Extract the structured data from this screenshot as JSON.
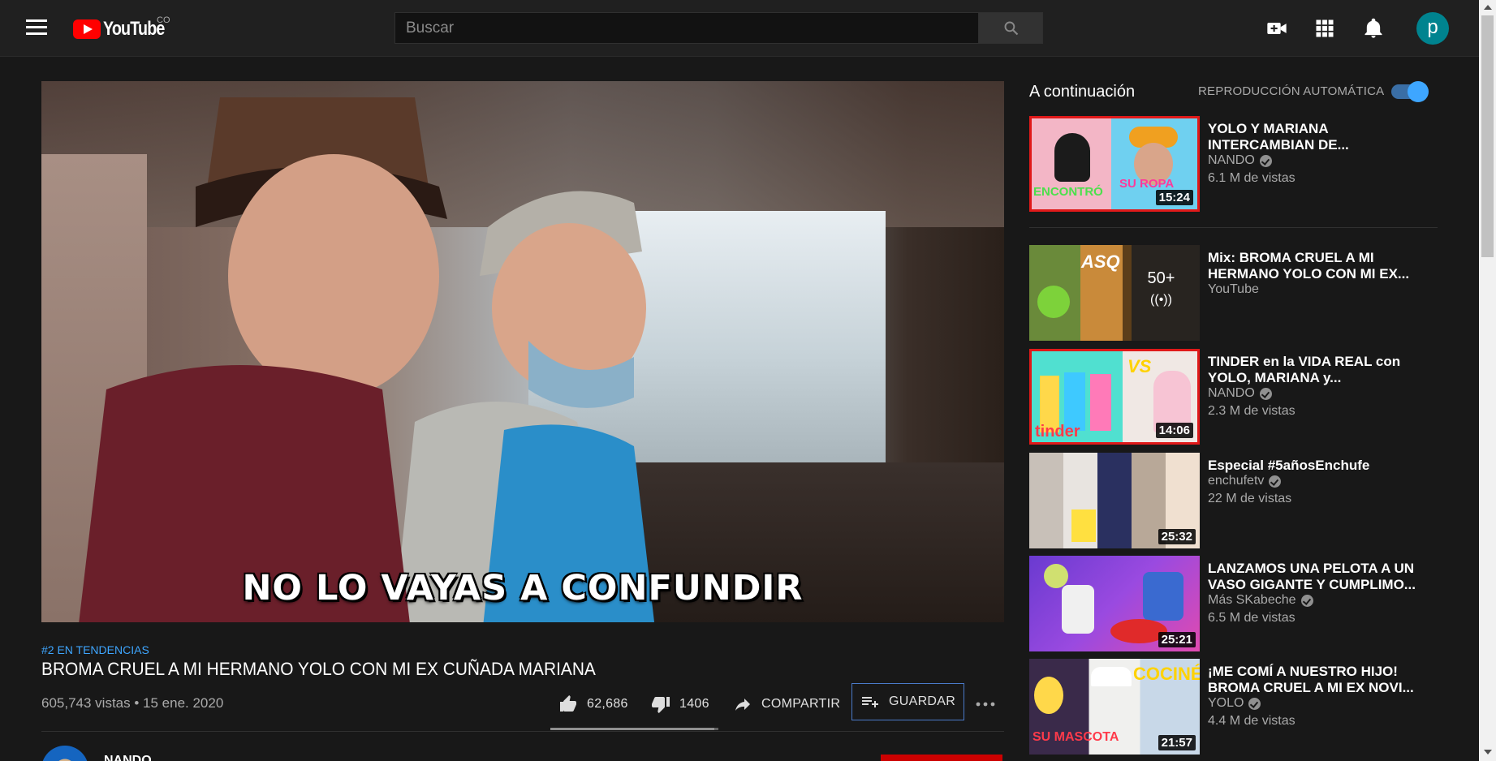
{
  "header": {
    "logo_text": "YouTube",
    "country_code": "CO",
    "search_placeholder": "Buscar",
    "avatar_letter": "p",
    "icons": [
      "menu-icon",
      "search-icon",
      "create-video-icon",
      "apps-icon",
      "notifications-icon"
    ]
  },
  "player": {
    "caption": "NO LO VAYAS A CONFUNDIR"
  },
  "video": {
    "trending": "#2 EN TENDENCIAS",
    "title": "BROMA CRUEL A MI HERMANO YOLO CON MI EX CUÑADA MARIANA",
    "meta": "605,743 vistas • 15 ene. 2020",
    "likes": "62,686",
    "dislikes": "1406",
    "share_label": "COMPARTIR",
    "save_label": "GUARDAR",
    "like_ratio": 0.978,
    "owner_name": "NANDO"
  },
  "sidebar": {
    "up_next": "A continuación",
    "autoplay_label": "REPRODUCCIÓN AUTOMÁTICA",
    "autoplay_on": true,
    "items": [
      {
        "title": "YOLO Y MARIANA INTERCAMBIAN DE...",
        "channel": "NANDO",
        "verified": true,
        "views": "6.1 M de vistas",
        "duration": "15:24"
      },
      {
        "title": "Mix: BROMA CRUEL A MI HERMANO YOLO CON MI EX...",
        "channel": "YouTube",
        "verified": false,
        "views": "",
        "mix_count": "50+",
        "mix_icon": "((•))"
      },
      {
        "title": "TINDER en la VIDA REAL con YOLO, MARIANA y...",
        "channel": "NANDO",
        "verified": true,
        "views": "2.3 M de vistas",
        "duration": "14:06"
      },
      {
        "title": "Especial #5añosEnchufe",
        "channel": "enchufetv",
        "verified": true,
        "views": "22 M de vistas",
        "duration": "25:32"
      },
      {
        "title": "LANZAMOS UNA PELOTA A UN VASO GIGANTE Y CUMPLIMO...",
        "channel": "Más SKabeche",
        "verified": true,
        "views": "6.5 M de vistas",
        "duration": "25:21"
      },
      {
        "title": "¡ME COMÍ A NUESTRO HIJO! BROMA CRUEL A MI EX NOVI...",
        "channel": "YOLO",
        "verified": true,
        "views": "4.4 M de vistas",
        "duration": "21:57"
      }
    ]
  },
  "colors": {
    "background": "#181818",
    "header": "#202020",
    "accent_blue": "#3ea6ff",
    "brand_red": "#ff0000"
  }
}
